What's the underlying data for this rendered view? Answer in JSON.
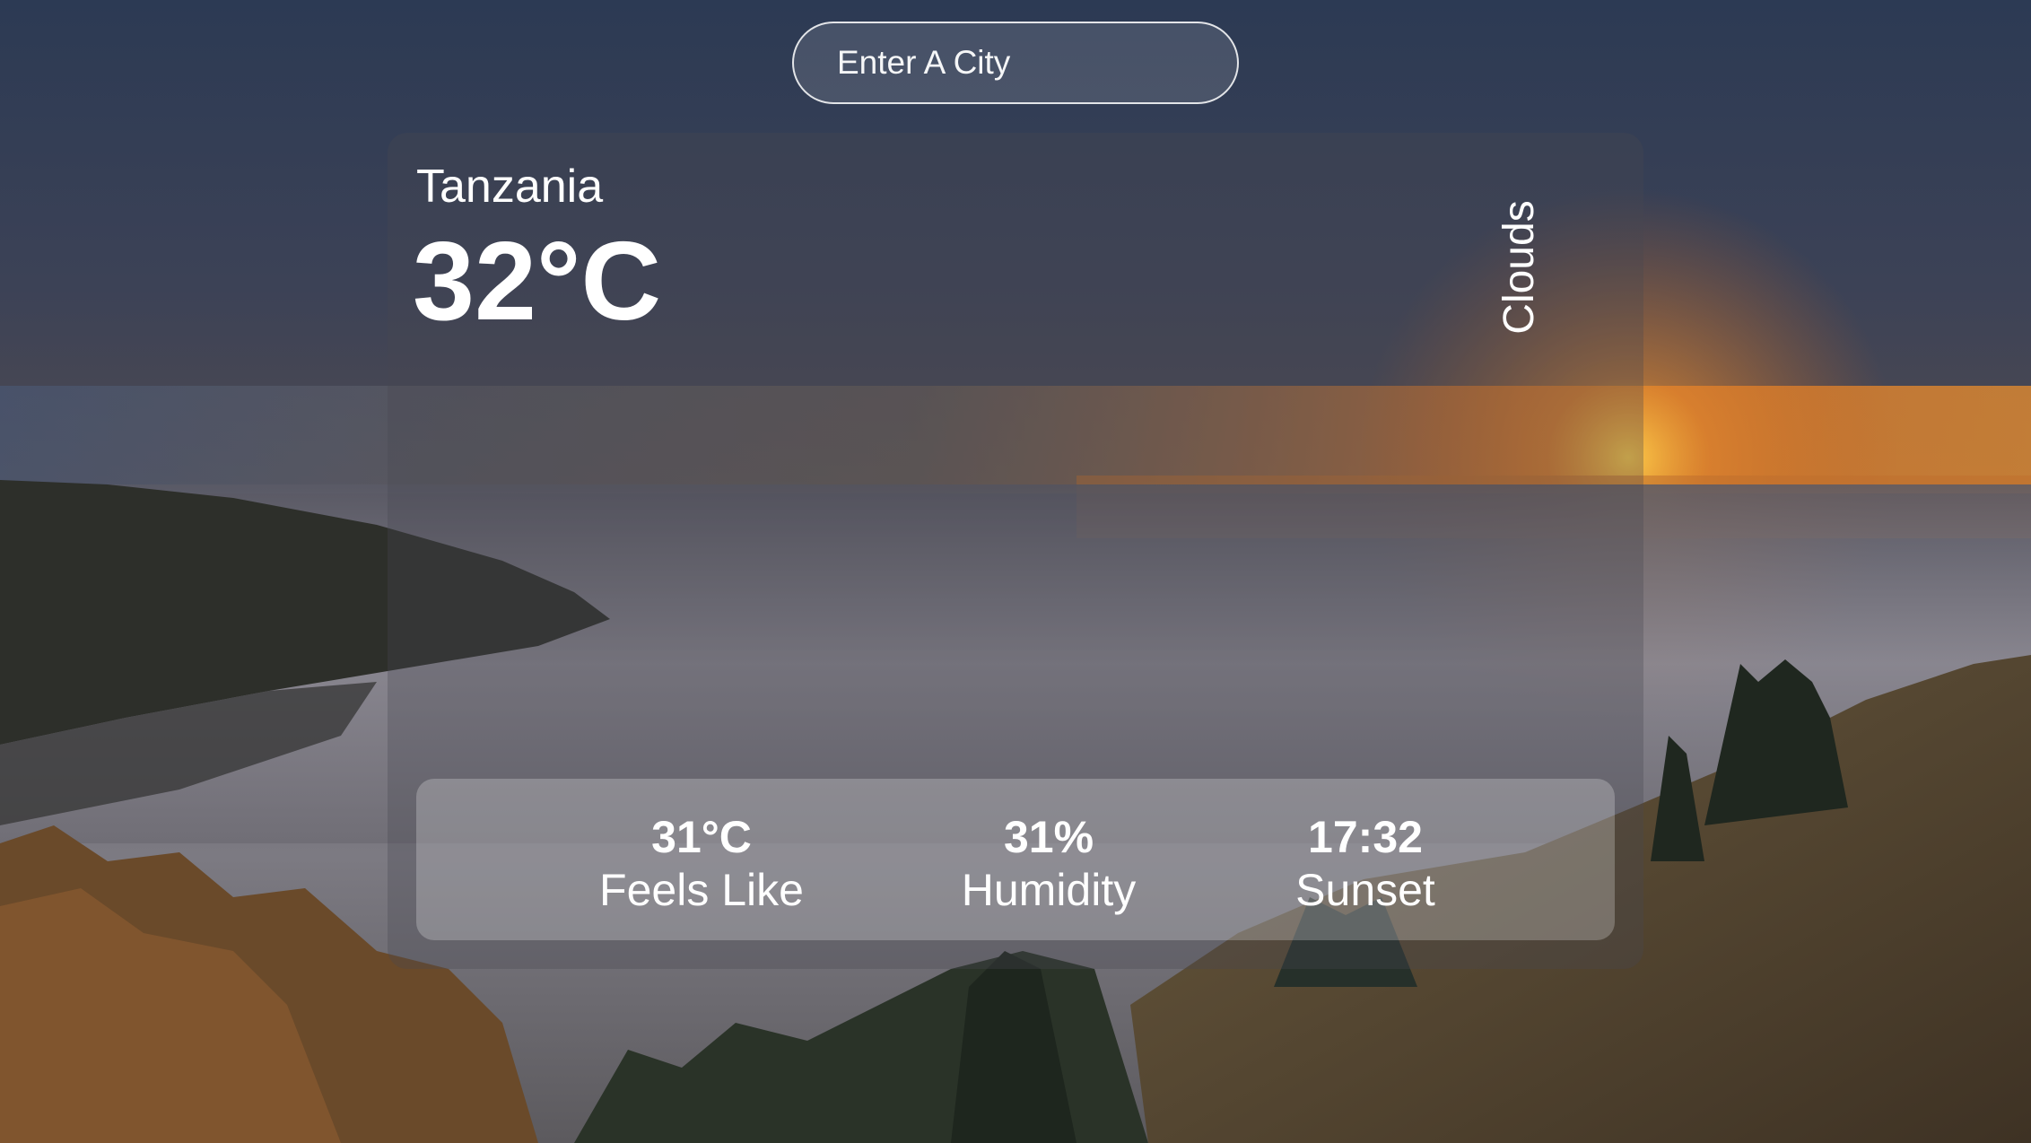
{
  "search": {
    "placeholder": "Enter A City"
  },
  "weather": {
    "city": "Tanzania",
    "temperature": "32°C",
    "condition": "Clouds"
  },
  "details": {
    "feels_like": {
      "value": "31°C",
      "label": "Feels Like"
    },
    "humidity": {
      "value": "31%",
      "label": "Humidity"
    },
    "sunset": {
      "value": "17:32",
      "label": "Sunset"
    }
  },
  "colors": {
    "sky_top": "#2d3c55",
    "sunset_orange": "#d9742a",
    "fog": "#8a8790",
    "hill": "#5a4a35",
    "text": "#ffffff"
  },
  "background": {
    "description_icon": "landscape-photo"
  }
}
